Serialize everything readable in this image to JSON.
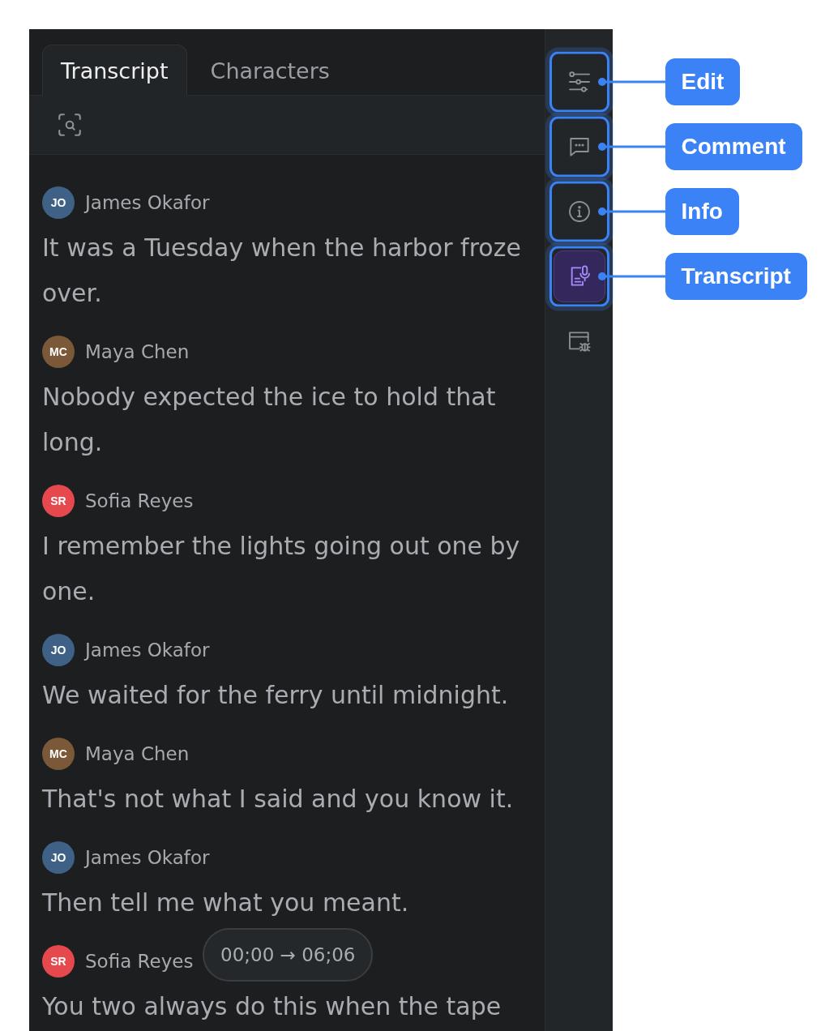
{
  "tabs": [
    {
      "label": "Transcript",
      "selected": true
    },
    {
      "label": "Characters",
      "selected": false
    }
  ],
  "entries": [
    {
      "speaker": "James Okafor",
      "initials": "JO",
      "color": "#3f6185",
      "text": "It was a Tuesday when the harbor froze over."
    },
    {
      "speaker": "Maya Chen",
      "initials": "MC",
      "color": "#7b5838",
      "text": "Nobody expected the ice to hold that long."
    },
    {
      "speaker": "Sofia Reyes",
      "initials": "SR",
      "color": "#e5484d",
      "text": "I remember the lights going out one by one."
    },
    {
      "speaker": "James Okafor",
      "initials": "JO",
      "color": "#3f6185",
      "text": "We waited for the ferry until midnight."
    },
    {
      "speaker": "Maya Chen",
      "initials": "MC",
      "color": "#7b5838",
      "text": "That's not what I said and you know it."
    },
    {
      "speaker": "James Okafor",
      "initials": "JO",
      "color": "#3f6185",
      "text": "Then tell me what you meant."
    },
    {
      "speaker": "Sofia Reyes",
      "initials": "SR",
      "color": "#e5484d",
      "text": "You two always do this when the tape"
    }
  ],
  "time_range": "00;00 → 06;06",
  "rail": [
    {
      "selected": false,
      "callout": "Edit"
    },
    {
      "selected": false,
      "callout": "Comment"
    },
    {
      "selected": false,
      "callout": "Info"
    },
    {
      "selected": true,
      "callout": "Transcript"
    },
    {
      "selected": false
    }
  ]
}
